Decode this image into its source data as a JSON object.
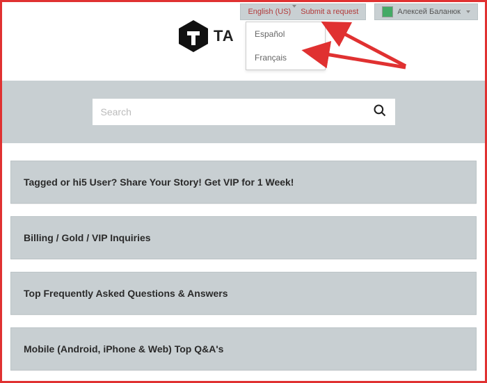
{
  "nav": {
    "language_label": "English (US)",
    "submit_request": "Submit a request",
    "user_name": "Алексей Баланюк"
  },
  "dropdown": {
    "items": [
      "Español",
      "Français"
    ]
  },
  "logo": {
    "text": "TA"
  },
  "search": {
    "placeholder": "Search"
  },
  "categories": [
    "Tagged or hi5 User? Share Your Story! Get VIP for 1 Week!",
    "Billing / Gold / VIP Inquiries",
    "Top Frequently Asked Questions & Answers",
    "Mobile (Android, iPhone & Web) Top Q&A's"
  ]
}
